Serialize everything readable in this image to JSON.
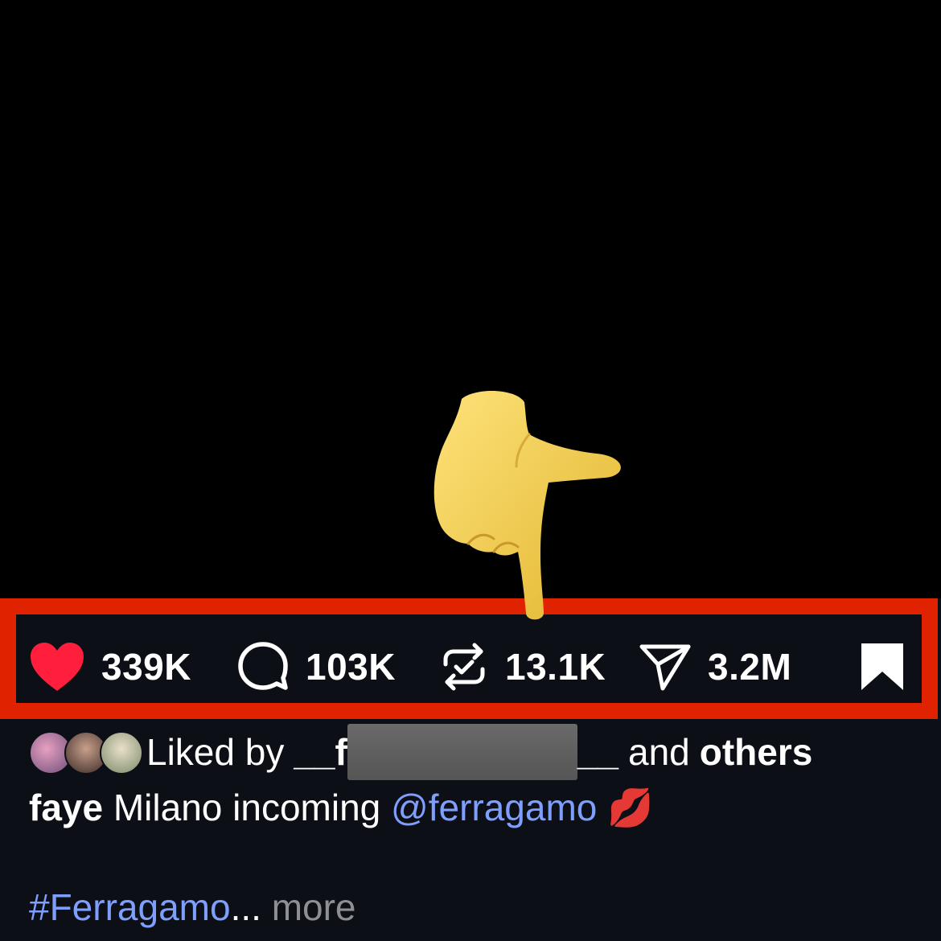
{
  "actions": {
    "like": {
      "icon": "heart-filled-icon",
      "count": "339K",
      "color": "#ff1f3d"
    },
    "comment": {
      "icon": "speech-bubble-icon",
      "count": "103K"
    },
    "repost": {
      "icon": "repost-icon",
      "count": "13.1K"
    },
    "share": {
      "icon": "paper-plane-icon",
      "count": "3.2M"
    },
    "save": {
      "icon": "bookmark-filled-icon"
    }
  },
  "liked_by": {
    "prefix": "Liked by",
    "username_start": "__f",
    "username_end": "__",
    "suffix_plain": "and",
    "suffix_bold": "others"
  },
  "caption": {
    "username": "faye",
    "text": "Milano incoming",
    "mention": "@ferragamo",
    "emoji": "💋",
    "hashtag": "#Ferragamo",
    "ellipsis": "...",
    "more": "more"
  },
  "colors": {
    "background_top": "#000000",
    "panel": "#0c0f16",
    "highlight": "#e02200",
    "link": "#7f9fff",
    "muted": "#8e8e93"
  },
  "overlay": {
    "icon": "pointing-down-hand-icon"
  }
}
